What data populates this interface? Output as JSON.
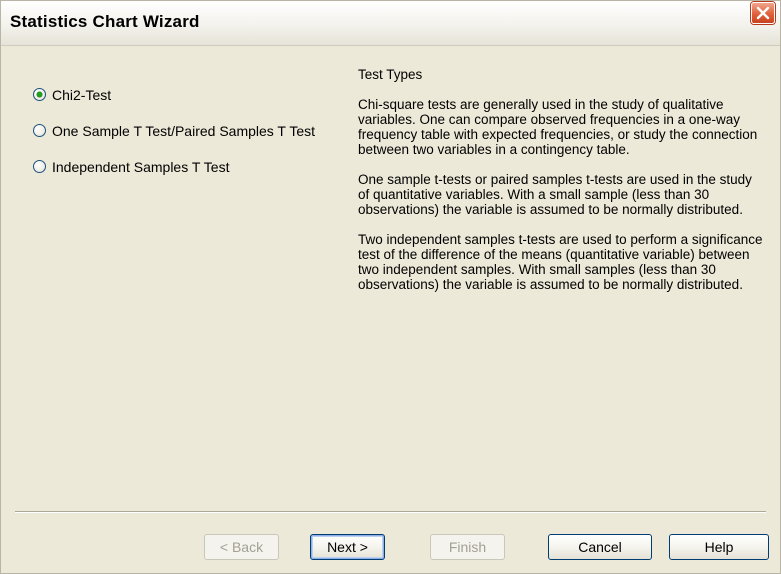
{
  "window": {
    "title": "Statistics Chart Wizard"
  },
  "test_options": [
    {
      "label": "Chi2-Test",
      "selected": true
    },
    {
      "label": "One Sample T Test/Paired Samples T Test",
      "selected": false
    },
    {
      "label": "Independent Samples T Test",
      "selected": false
    }
  ],
  "info": {
    "heading": "Test Types",
    "paragraphs": [
      "Chi-square tests are generally used in the study of qualitative variables. One can compare observed frequencies in a one-way frequency table with expected frequencies, or study the connection between two variables in a contingency table.",
      "One sample t-tests or paired samples t-tests are used in the study of quantitative variables. With a small sample (less than 30 observations) the variable is assumed to be normally distributed.",
      "Two independent samples t-tests are used to perform a significance test of the difference of the means (quantitative variable) between two independent samples. With small samples (less than 30 observations) the variable is assumed to be normally distributed."
    ]
  },
  "buttons": {
    "back": "< Back",
    "next": "Next >",
    "finish": "Finish",
    "cancel": "Cancel",
    "help": "Help"
  },
  "colors": {
    "dialog_background": "#ece9d8",
    "radio_selected_dot": "#21a121",
    "close_button": "#e0603b"
  }
}
